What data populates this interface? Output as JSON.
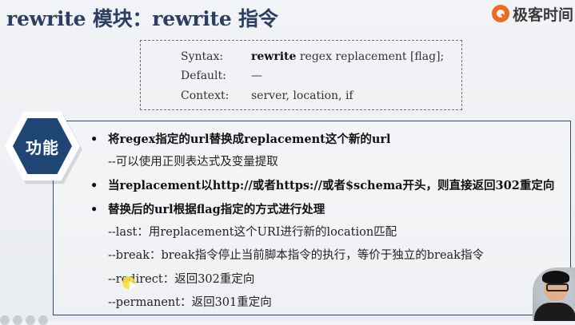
{
  "title": "rewrite 模块：rewrite 指令",
  "logo": {
    "text": "极客时间",
    "brand_color": "#ee6a1e"
  },
  "syntax": {
    "rows": [
      {
        "key": "Syntax:",
        "value_bold": "rewrite",
        "value_rest": " regex replacement [flag];"
      },
      {
        "key": "Default:",
        "value_bold": "",
        "value_rest": "—"
      },
      {
        "key": "Context:",
        "value_bold": "",
        "value_rest": "server, location, if"
      }
    ]
  },
  "badge": {
    "label": "功能",
    "color": "#1f4575"
  },
  "content": {
    "bullet_marker": "•",
    "lines": [
      {
        "kind": "bullet",
        "text": "将regex指定的url替换成replacement这个新的url"
      },
      {
        "kind": "sub",
        "text": "--可以使用正则表达式及变量提取"
      },
      {
        "kind": "bullet",
        "text": "当replacement以http://或者https://或者$schema开头，则直接返回302重定向"
      },
      {
        "kind": "bullet",
        "text": "替换后的url根据flag指定的方式进行处理"
      },
      {
        "kind": "sub",
        "text": "--last：用replacement这个URI进行新的location匹配"
      },
      {
        "kind": "sub",
        "text": "--break：break指令停止当前脚本指令的执行，等价于独立的break指令"
      },
      {
        "kind": "sub",
        "text": "--redirect：返回302重定向"
      },
      {
        "kind": "sub",
        "text": "--permanent：返回301重定向"
      }
    ]
  },
  "accent_color": "#2b3f63"
}
